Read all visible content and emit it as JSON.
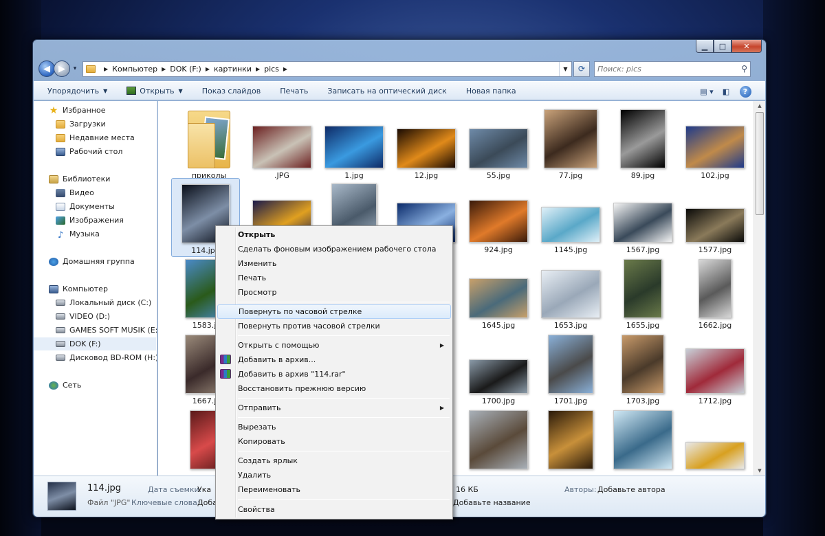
{
  "window": {
    "caption_buttons": {
      "minimize": "▁",
      "maximize": "□",
      "close": "✕"
    }
  },
  "address": {
    "path": [
      "Компьютер",
      "DOK (F:)",
      "картинки",
      "pics"
    ],
    "search_placeholder": "Поиск: pics"
  },
  "toolbar": {
    "organize": "Упорядочить",
    "open": "Открыть",
    "slideshow": "Показ слайдов",
    "print": "Печать",
    "burn": "Записать на оптический диск",
    "new_folder": "Новая папка"
  },
  "nav": {
    "favorites": "Избранное",
    "downloads": "Загрузки",
    "recent": "Недавние места",
    "desktop": "Рабочий стол",
    "libraries": "Библиотеки",
    "video": "Видео",
    "documents": "Документы",
    "images": "Изображения",
    "music": "Музыка",
    "homegroup": "Домашняя группа",
    "computer": "Компьютер",
    "drive_c": "Локальный диск (C:)",
    "drive_d": "VIDEO (D:)",
    "drive_e": "GAMES SOFT MUSIK (E:)",
    "drive_f": "DOK (F:)",
    "drive_h": "Дисковод BD-ROM (H:) F",
    "network": "Сеть"
  },
  "files": [
    {
      "name": "приколы",
      "kind": "folder"
    },
    {
      "name": ".JPG",
      "colors": [
        "#6b2020",
        "#c9c2b6"
      ]
    },
    {
      "name": "1.jpg",
      "colors": [
        "#0e2a66",
        "#3a9ae0"
      ]
    },
    {
      "name": "12.jpg",
      "colors": [
        "#1a0b02",
        "#e08a1a"
      ]
    },
    {
      "name": "55.jpg",
      "colors": [
        "#6e8aa8",
        "#3b4a58"
      ]
    },
    {
      "name": "77.jpg",
      "colors": [
        "#c9a27a",
        "#3c2a1e"
      ]
    },
    {
      "name": "89.jpg",
      "colors": [
        "#000000",
        "#9a9a9a"
      ]
    },
    {
      "name": "102.jpg",
      "colors": [
        "#1e3a8a",
        "#c08a4a"
      ]
    },
    {
      "name": "114.jpg",
      "colors": [
        "#0a0f1a",
        "#7d8ea6"
      ]
    },
    {
      "name": "",
      "colors": [
        "#1a1a4a",
        "#e0a020"
      ]
    },
    {
      "name": "",
      "colors": [
        "#a9b9c9",
        "#4a5a6a"
      ]
    },
    {
      "name": "",
      "colors": [
        "#0a2a6a",
        "#8ab0e0"
      ]
    },
    {
      "name": "924.jpg",
      "colors": [
        "#3a1a0a",
        "#e07a2a"
      ]
    },
    {
      "name": "1145.jpg",
      "colors": [
        "#e0f0f8",
        "#5aa8c8"
      ]
    },
    {
      "name": "1567.jpg",
      "colors": [
        "#f4f4f4",
        "#3a4a5a"
      ]
    },
    {
      "name": "1577.jpg",
      "colors": [
        "#0a0a08",
        "#8a7a5a"
      ]
    },
    {
      "name": "1583.jpg",
      "colors": [
        "#4a8ac8",
        "#2a5a1a"
      ]
    },
    {
      "name": "1645.jpg",
      "colors": [
        "#c8a06a",
        "#4a6a7a"
      ]
    },
    {
      "name": "1653.jpg",
      "colors": [
        "#e8eef4",
        "#9aa8b8"
      ]
    },
    {
      "name": "1655.jpg",
      "colors": [
        "#6a7a4a",
        "#2a3a2a"
      ]
    },
    {
      "name": "1662.jpg",
      "colors": [
        "#d8d8d8",
        "#5a5a5a"
      ]
    },
    {
      "name": "1667.jpg",
      "colors": [
        "#9a8a7a",
        "#3a2a2a"
      ]
    },
    {
      "name": "1700.jpg",
      "colors": [
        "#8a9aa8",
        "#1a1a1a"
      ]
    },
    {
      "name": "1701.jpg",
      "colors": [
        "#8ab0d8",
        "#4a4a4a"
      ]
    },
    {
      "name": "1703.jpg",
      "colors": [
        "#c89a6a",
        "#4a3a2a"
      ]
    },
    {
      "name": "1712.jpg",
      "colors": [
        "#c8d0d8",
        "#a02a3a"
      ]
    },
    {
      "name": "",
      "colors": [
        "#5a1a1a",
        "#d84a4a"
      ]
    },
    {
      "name": "",
      "colors": [
        "#a8b0b8",
        "#5a4a3a"
      ]
    },
    {
      "name": "",
      "colors": [
        "#2a1a0a",
        "#c8903a"
      ]
    },
    {
      "name": "",
      "colors": [
        "#d0e8f4",
        "#3a6a8a"
      ]
    },
    {
      "name": "",
      "colors": [
        "#e8e8e8",
        "#d8a020"
      ]
    }
  ],
  "context_menu": {
    "open": "Открыть",
    "set_wallpaper": "Сделать фоновым изображением рабочего стола",
    "edit": "Изменить",
    "print": "Печать",
    "preview": "Просмотр",
    "rotate_cw": "Повернуть по часовой стрелке",
    "rotate_ccw": "Повернуть против часовой стрелки",
    "open_with": "Открыть с помощью",
    "add_archive": "Добавить в архив...",
    "add_archive_named": "Добавить в архив \"114.rar\"",
    "restore_version": "Восстановить прежнюю версию",
    "send_to": "Отправить",
    "cut": "Вырезать",
    "copy": "Копировать",
    "create_shortcut": "Создать ярлык",
    "delete": "Удалить",
    "rename": "Переименовать",
    "properties": "Свойства"
  },
  "details": {
    "name": "114.jpg",
    "type": "Файл \"JPG\"",
    "date_label": "Дата съемки:",
    "date_value": "Ука",
    "keywords_label": "Ключевые слова:",
    "keywords_value": "Доба",
    "size_value": "16 КБ",
    "title_value": "Добавьте название",
    "authors_label": "Авторы:",
    "authors_value": "Добавьте автора"
  }
}
